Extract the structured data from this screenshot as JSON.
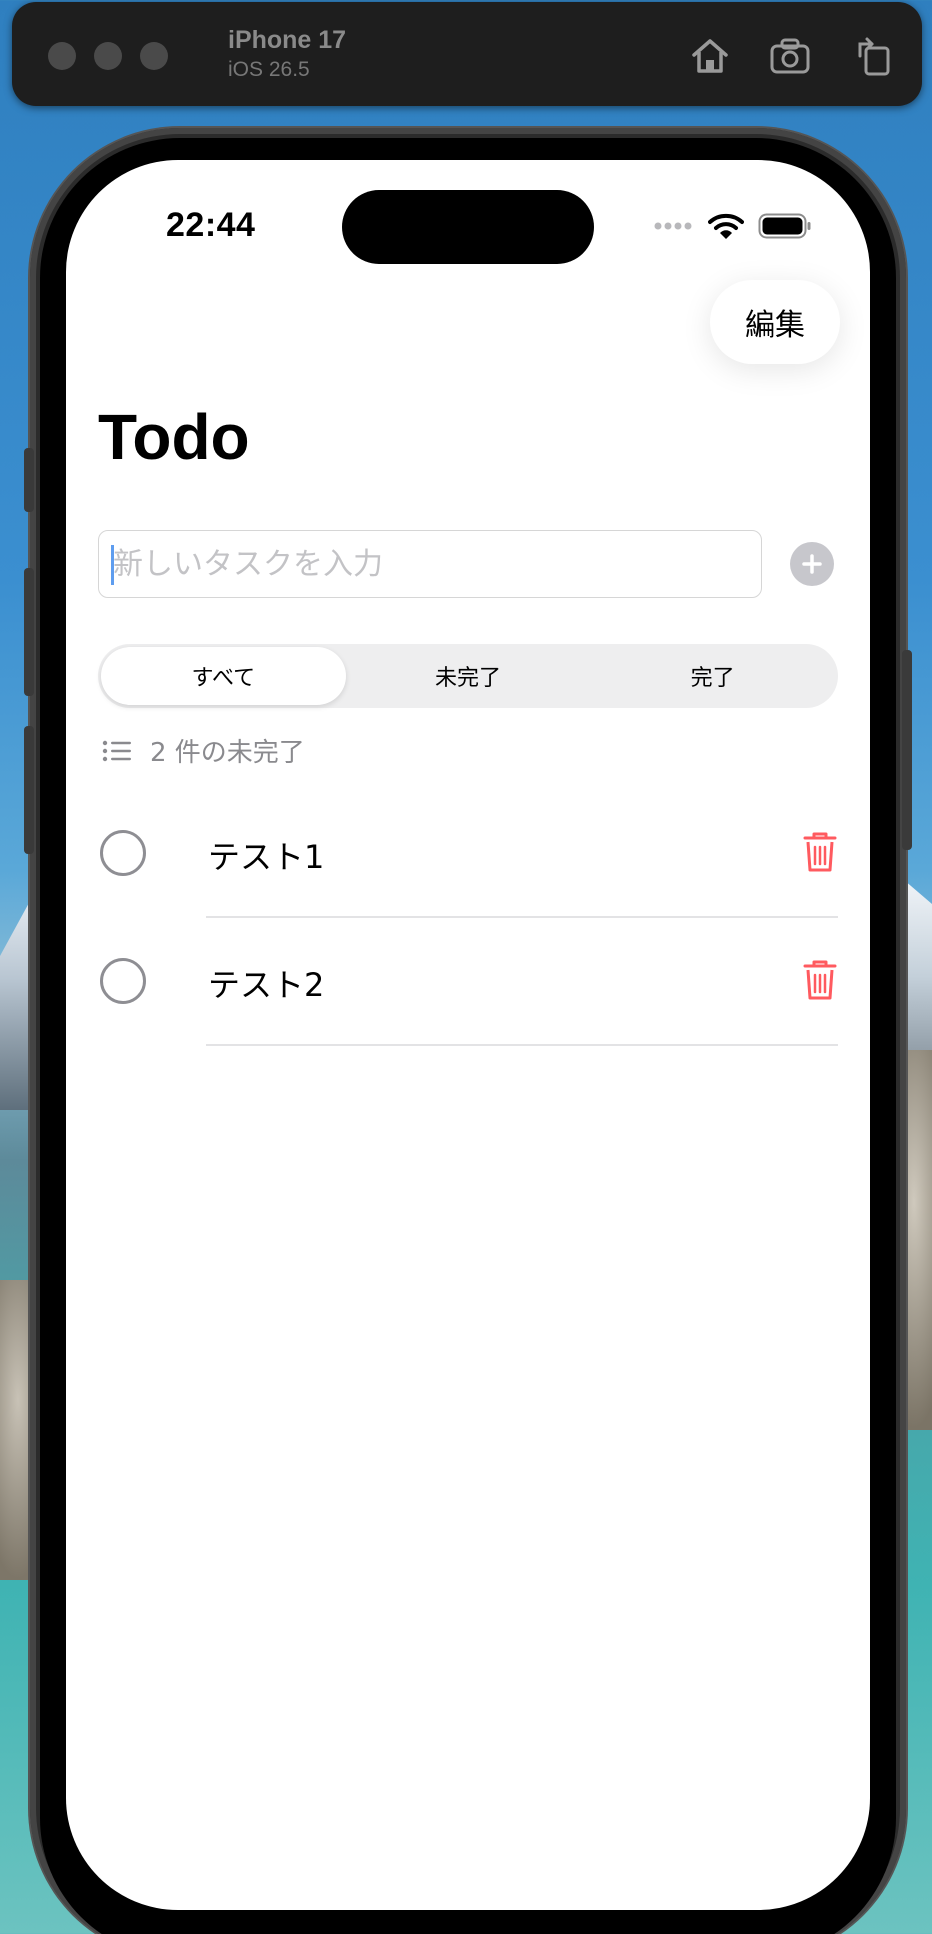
{
  "simulator": {
    "device_name": "iPhone 17",
    "os_version": "iOS 26.5",
    "icons": [
      "home-icon",
      "screenshot-icon",
      "rotate-icon"
    ]
  },
  "status_bar": {
    "time": "22:44",
    "icons": [
      "signal-dots-icon",
      "wifi-icon",
      "battery-icon"
    ]
  },
  "nav": {
    "edit_label": "編集",
    "title": "Todo"
  },
  "new_task": {
    "placeholder": "新しいタスクを入力",
    "value": "",
    "add_icon": "plus-circle-icon"
  },
  "filter": {
    "options": [
      "すべて",
      "未完了",
      "完了"
    ],
    "selected": "すべて"
  },
  "summary": {
    "icon": "list-icon",
    "text": "2 件の未完了"
  },
  "tasks": [
    {
      "title": "テスト1",
      "done": false
    },
    {
      "title": "テスト2",
      "done": false
    }
  ],
  "colors": {
    "delete": "#ff5a5f",
    "secondary_text": "#8a8a8e",
    "unchecked_circle": "#8e8e93"
  }
}
